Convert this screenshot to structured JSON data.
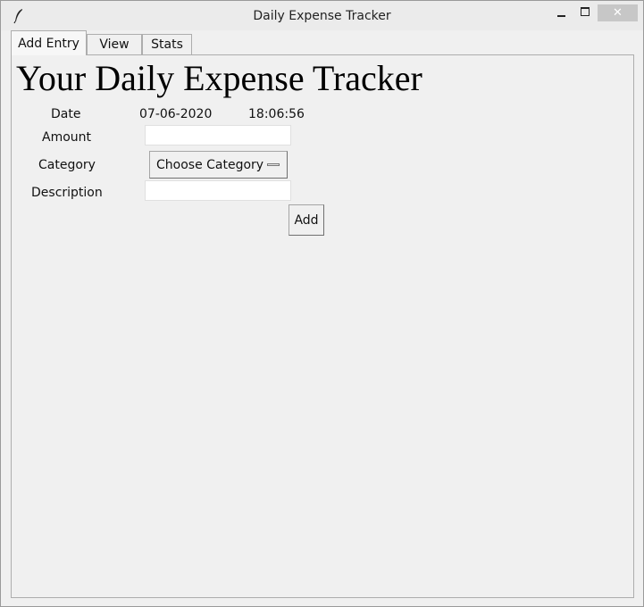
{
  "window": {
    "title": "Daily Expense Tracker",
    "close_symbol": "✕"
  },
  "tabs": [
    {
      "label": "Add Entry",
      "active": true
    },
    {
      "label": "View",
      "active": false
    },
    {
      "label": "Stats",
      "active": false
    }
  ],
  "form": {
    "heading": "Your Daily Expense Tracker",
    "date_label": "Date",
    "date_value": "07-06-2020",
    "time_value": "18:06:56",
    "amount_label": "Amount",
    "amount_value": "",
    "category_label": "Category",
    "category_selected": "Choose Category",
    "description_label": "Description",
    "description_value": "",
    "add_label": "Add"
  },
  "colors": {
    "window_bg": "#f0f0f0",
    "close_button_bg": "#c7c7c7"
  }
}
